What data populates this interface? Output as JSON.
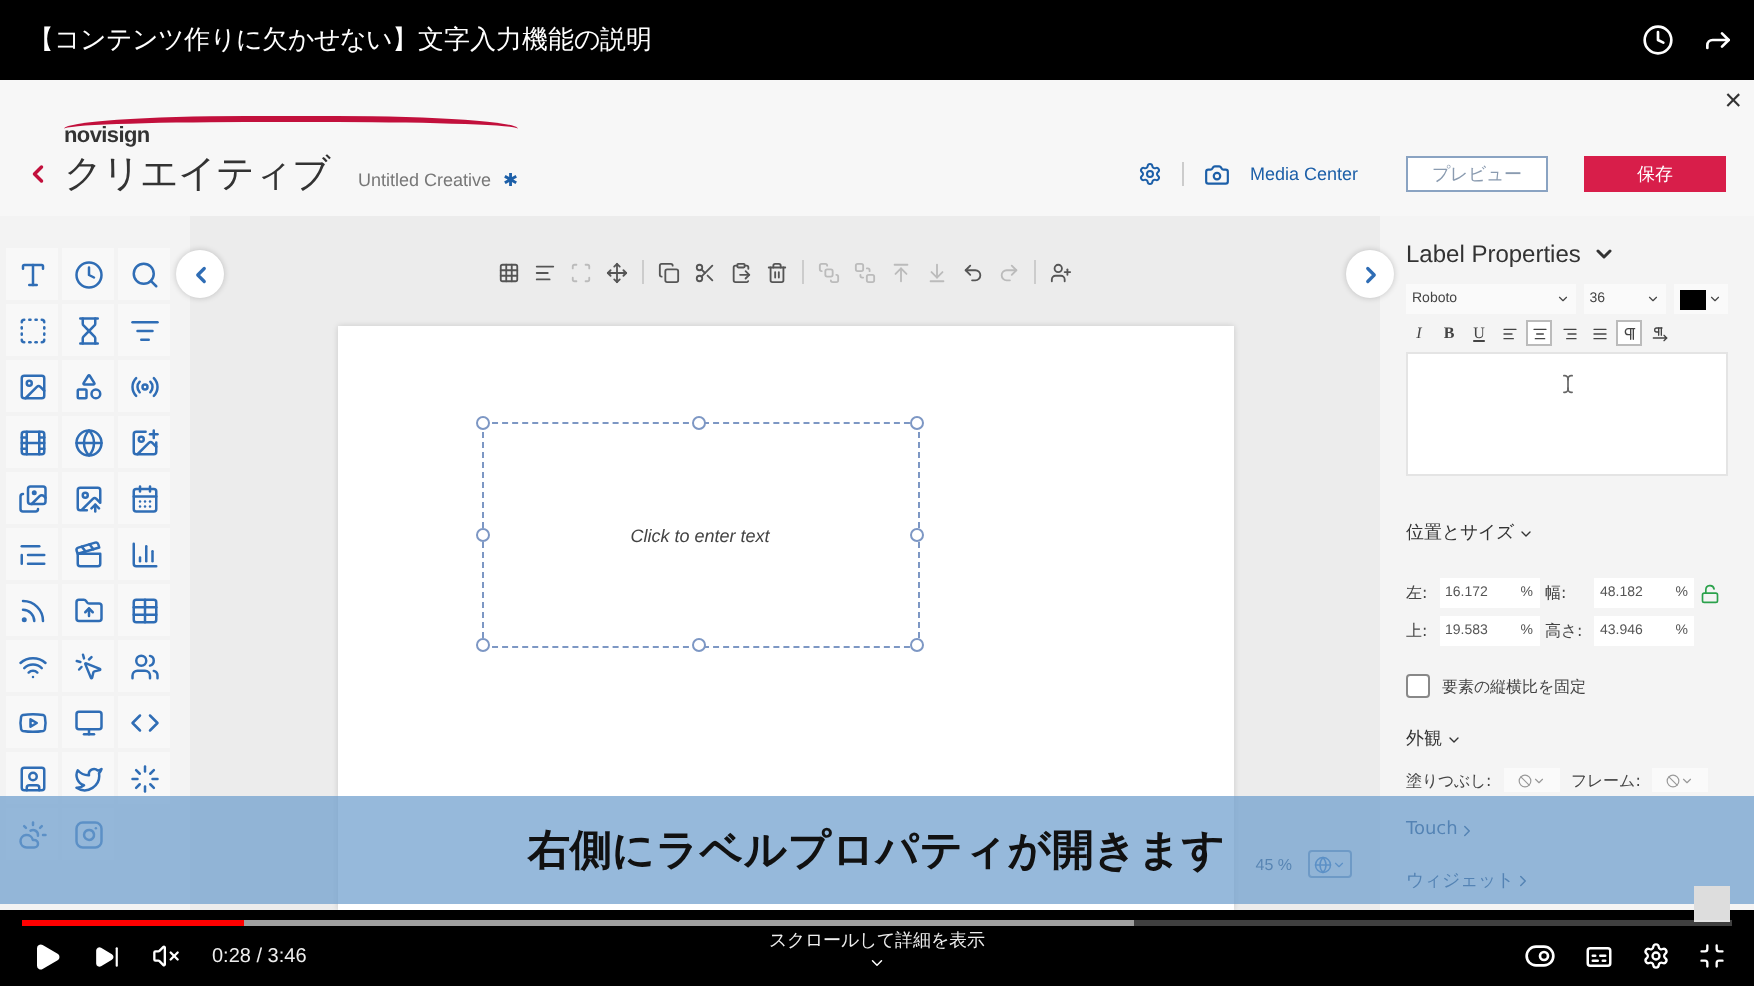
{
  "video": {
    "title": "【コンテンツ作りに欠かせない】文字入力機能の説明"
  },
  "app": {
    "logo": "novisign",
    "section": "クリエイティブ",
    "document": "Untitled Creative",
    "unsaved_mark": "✱",
    "media_center": "Media Center",
    "preview_button": "プレビュー",
    "save_button": "保存",
    "close": "×"
  },
  "canvas_toolbar": [
    {
      "disabled": false
    },
    {
      "disabled": false
    },
    {
      "disabled": true
    },
    {
      "disabled": false
    },
    {
      "disabled": false
    },
    {
      "disabled": false
    },
    {
      "disabled": false
    },
    {
      "disabled": false
    },
    {
      "disabled": true
    },
    {
      "disabled": true
    },
    {
      "disabled": true
    },
    {
      "disabled": true
    },
    {
      "disabled": false
    },
    {
      "disabled": true
    },
    {
      "disabled": false
    }
  ],
  "canvas": {
    "placeholder_text": "Click to enter text",
    "zoom": "45 %"
  },
  "properties": {
    "title": "Label Properties",
    "font": "Roboto",
    "size": "36",
    "text_color": {
      "color": "#000000"
    },
    "format_buttons": [
      {
        "kind": "letter",
        "label": "I",
        "selected": false
      },
      {
        "kind": "letter",
        "label": "B",
        "selected": false
      },
      {
        "kind": "letter",
        "label": "U",
        "selected": false
      },
      {
        "kind": "icon",
        "selected": false
      },
      {
        "kind": "icon",
        "selected": true
      },
      {
        "kind": "icon",
        "selected": false
      },
      {
        "kind": "icon",
        "selected": false
      },
      {
        "kind": "icon",
        "selected": true
      },
      {
        "kind": "icon",
        "selected": false
      }
    ],
    "position": {
      "title": "位置とサイズ",
      "fields": [
        {
          "label": "左:",
          "value": "16.172",
          "unit": "%"
        },
        {
          "label": "幅:",
          "value": "48.182",
          "unit": "%"
        },
        {
          "label": "上:",
          "value": "19.583",
          "unit": "%"
        },
        {
          "label": "高さ:",
          "value": "43.946",
          "unit": "%"
        }
      ],
      "locked": false,
      "aspect_lock": {
        "label": "要素の縦横比を固定",
        "checked": false
      }
    },
    "appearance": {
      "title": "外観",
      "fill_label": "塗りつぶし:",
      "frame_label": "フレーム:"
    },
    "links": [
      "Touch",
      "ウィジェット"
    ]
  },
  "subtitle": "右側にラベルプロパティが開きます",
  "player": {
    "progress": {
      "level": 0.13
    },
    "buffer": {
      "level": 0.65
    },
    "time": "0:28 / 3:46",
    "scroll_hint": "スクロールして詳細を表示"
  }
}
